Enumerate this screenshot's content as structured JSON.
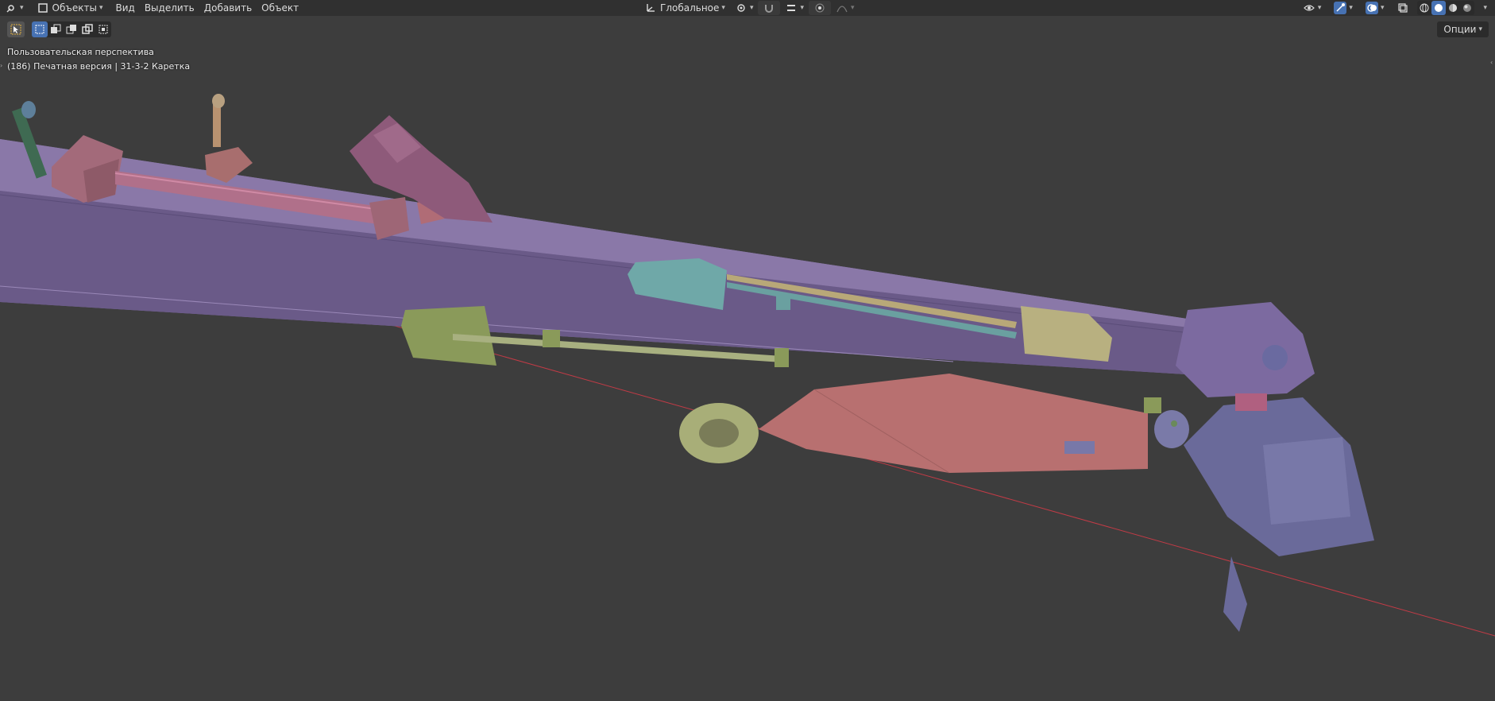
{
  "header": {
    "editor_icon": "editor-type-icon",
    "mode_label": "Объекты",
    "menu": [
      "Вид",
      "Выделить",
      "Добавить",
      "Объект"
    ],
    "transform_orientation": "Глобальное"
  },
  "tool_settings": {
    "options_label": "Опции"
  },
  "viewport": {
    "view_name": "Пользовательская перспектива",
    "object_info": "(186) Печатная версия | 31-3-2 Каретка"
  },
  "colors": {
    "background": "#3d3d3d",
    "header": "#303030",
    "accent": "#4772b3",
    "x_axis": "#c23b46"
  }
}
